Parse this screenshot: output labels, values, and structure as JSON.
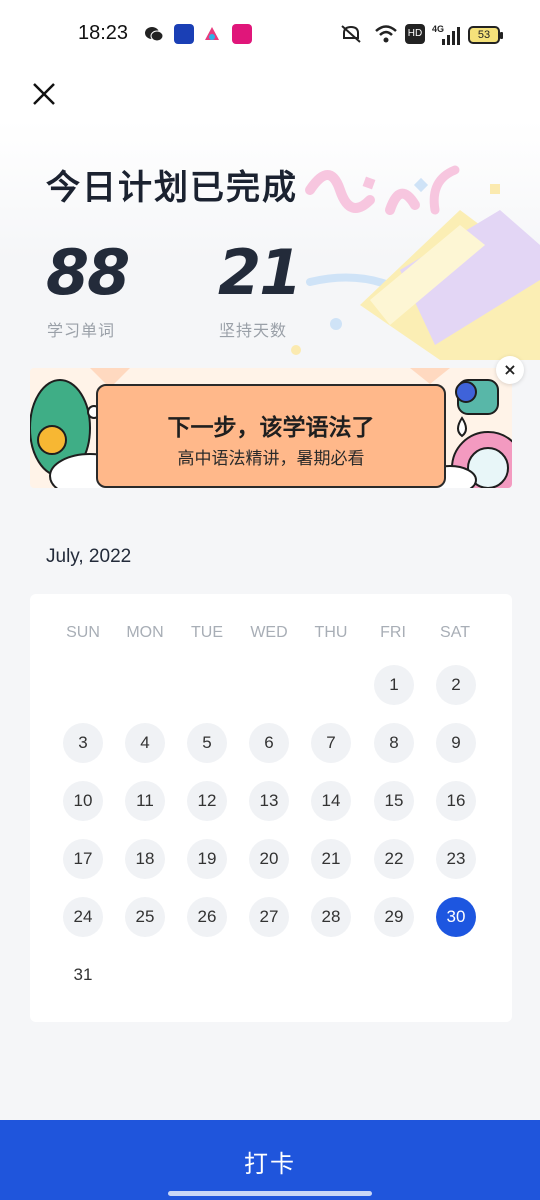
{
  "status_bar": {
    "time": "18:23",
    "network": "4G",
    "hd": "HD",
    "battery": "53"
  },
  "header": {
    "title": "今日计划已完成"
  },
  "stats": [
    {
      "value": "88",
      "label": "学习单词"
    },
    {
      "value": "21",
      "label": "坚持天数"
    }
  ],
  "banner": {
    "title": "下一步，该学语法了",
    "subtitle": "高中语法精讲，暑期必看",
    "close": "×"
  },
  "calendar": {
    "month": "July, 2022",
    "weekdays": [
      "SUN",
      "MON",
      "TUE",
      "WED",
      "THU",
      "FRI",
      "SAT"
    ],
    "days": [
      "1",
      "2",
      "3",
      "4",
      "5",
      "6",
      "7",
      "8",
      "9",
      "10",
      "11",
      "12",
      "13",
      "14",
      "15",
      "16",
      "17",
      "18",
      "19",
      "20",
      "21",
      "22",
      "23",
      "24",
      "25",
      "26",
      "27",
      "28",
      "29",
      "30",
      "31"
    ],
    "selected_day": "30"
  },
  "checkin_button": {
    "label": "打卡"
  },
  "colors": {
    "accent": "#1f55dc",
    "selected_day": "#1d56e0",
    "banner_card": "#ffb88a"
  }
}
